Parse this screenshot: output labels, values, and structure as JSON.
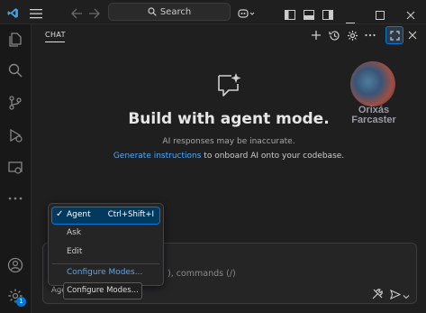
{
  "titlebar": {
    "search_label": "Search"
  },
  "chat": {
    "tab_label": "CHAT",
    "headline": "Build with agent mode.",
    "disclaimer": "AI responses may be inaccurate.",
    "instructions_link": "Generate instructions",
    "instructions_text": " to onboard AI onto your codebase.",
    "input_placeholder_tail": "), commands (/)",
    "mode_button_label": "Age"
  },
  "mode_menu": {
    "items": [
      {
        "label": "Agent",
        "shortcut": "Ctrl+Shift+I",
        "selected": true
      },
      {
        "label": "Ask",
        "shortcut": "",
        "selected": false
      },
      {
        "label": "Edit",
        "shortcut": "",
        "selected": false
      }
    ],
    "configure_label": "Configure Modes...",
    "tooltip": "Configure Modes..."
  },
  "activity_bar": {
    "items": [
      "explorer-icon",
      "search-icon",
      "source-control-icon",
      "run-debug-icon",
      "remote-explorer-icon",
      "more-icon"
    ],
    "accounts_icon": "account-icon",
    "settings_icon": "gear-icon",
    "settings_badge": "1"
  },
  "logo": {
    "line1": "Orixás",
    "line2": "Farcaster"
  },
  "colors": {
    "accent": "#0078d4",
    "link": "#4daafc",
    "background": "#1f1f1f"
  }
}
